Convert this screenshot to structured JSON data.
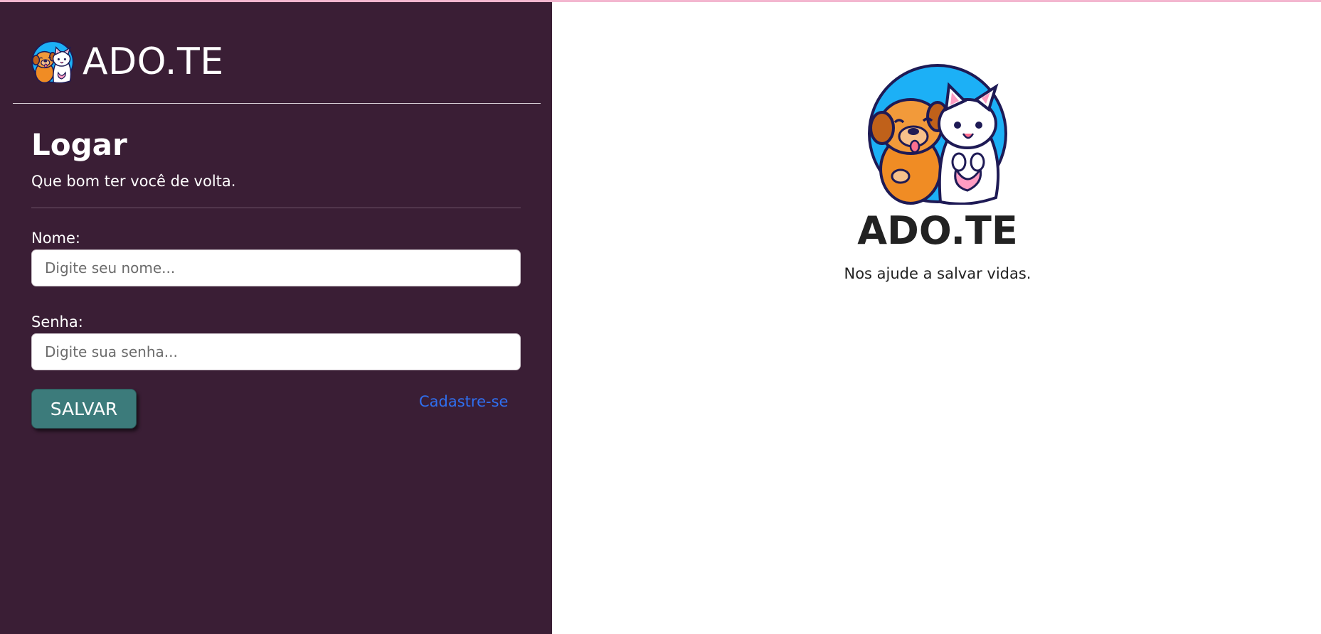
{
  "app": {
    "brand_name": "ADO.TE"
  },
  "login": {
    "title": "Logar",
    "subtitle": "Que bom ter você de volta.",
    "name_label": "Nome:",
    "name_placeholder": "Digite seu nome...",
    "name_value": "",
    "password_label": "Senha:",
    "password_placeholder": "Digite sua senha...",
    "password_value": "",
    "save_label": "SALVAR",
    "signup_label": "Cadastre-se"
  },
  "hero": {
    "brand_name": "ADO.TE",
    "tagline": "Nos ajude a salvar vidas.",
    "logo_icon": "dog-and-cat-logo-icon"
  },
  "colors": {
    "sidebar_bg": "#3a1e35",
    "button_bg": "#3c7b7b",
    "link": "#2f6ff0",
    "logo_circle": "#1cb0f6",
    "dog": "#f08c24",
    "outline": "#1e1a55"
  }
}
